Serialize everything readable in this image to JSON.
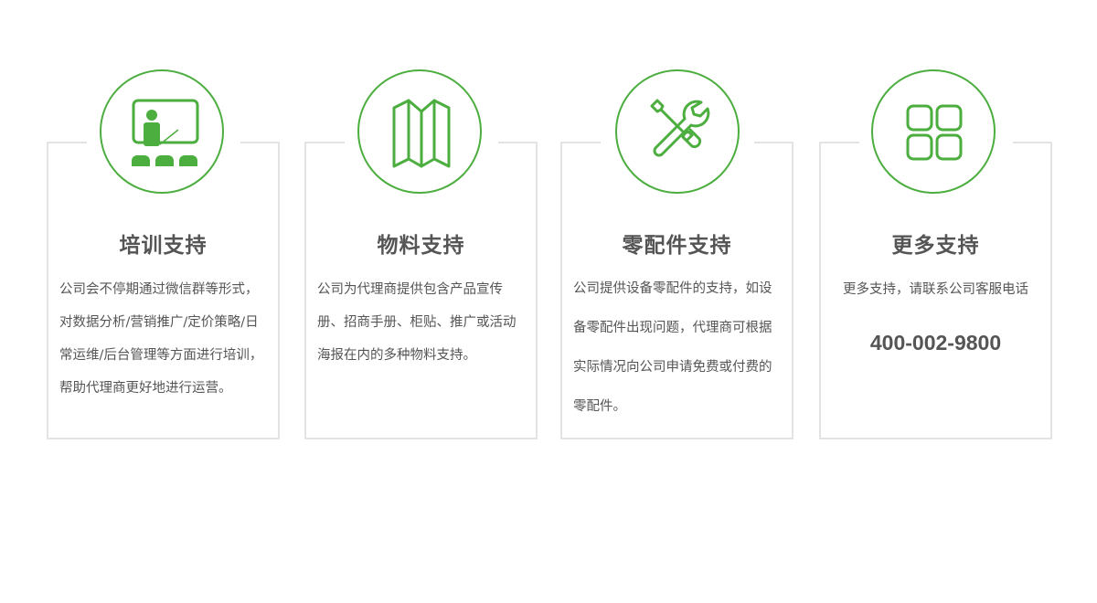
{
  "theme": {
    "accent": "#4cae3f",
    "border": "#e3e3e3",
    "text": "#555555"
  },
  "cards": [
    {
      "icon": "training-classroom-icon",
      "title": "培训支持",
      "description": "公司会不停期通过微信群等形式，对数据分析/营销推广/定价策略/日常运维/后台管理等方面进行培训，帮助代理商更好地进行运营。"
    },
    {
      "icon": "folded-map-icon",
      "title": "物料支持",
      "description": "公司为代理商提供包含产品宣传册、招商手册、柜贴、推广或活动海报在内的多种物料支持。"
    },
    {
      "icon": "wrench-screwdriver-icon",
      "title": "零配件支持",
      "description": "公司提供设备零配件的支持，如设备零配件出现问题，代理商可根据实际情况向公司申请免费或付费的零配件。"
    },
    {
      "icon": "grid-apps-icon",
      "title": "更多支持",
      "description": "更多支持，请联系公司客服电话",
      "phone": "400-002-9800"
    }
  ]
}
